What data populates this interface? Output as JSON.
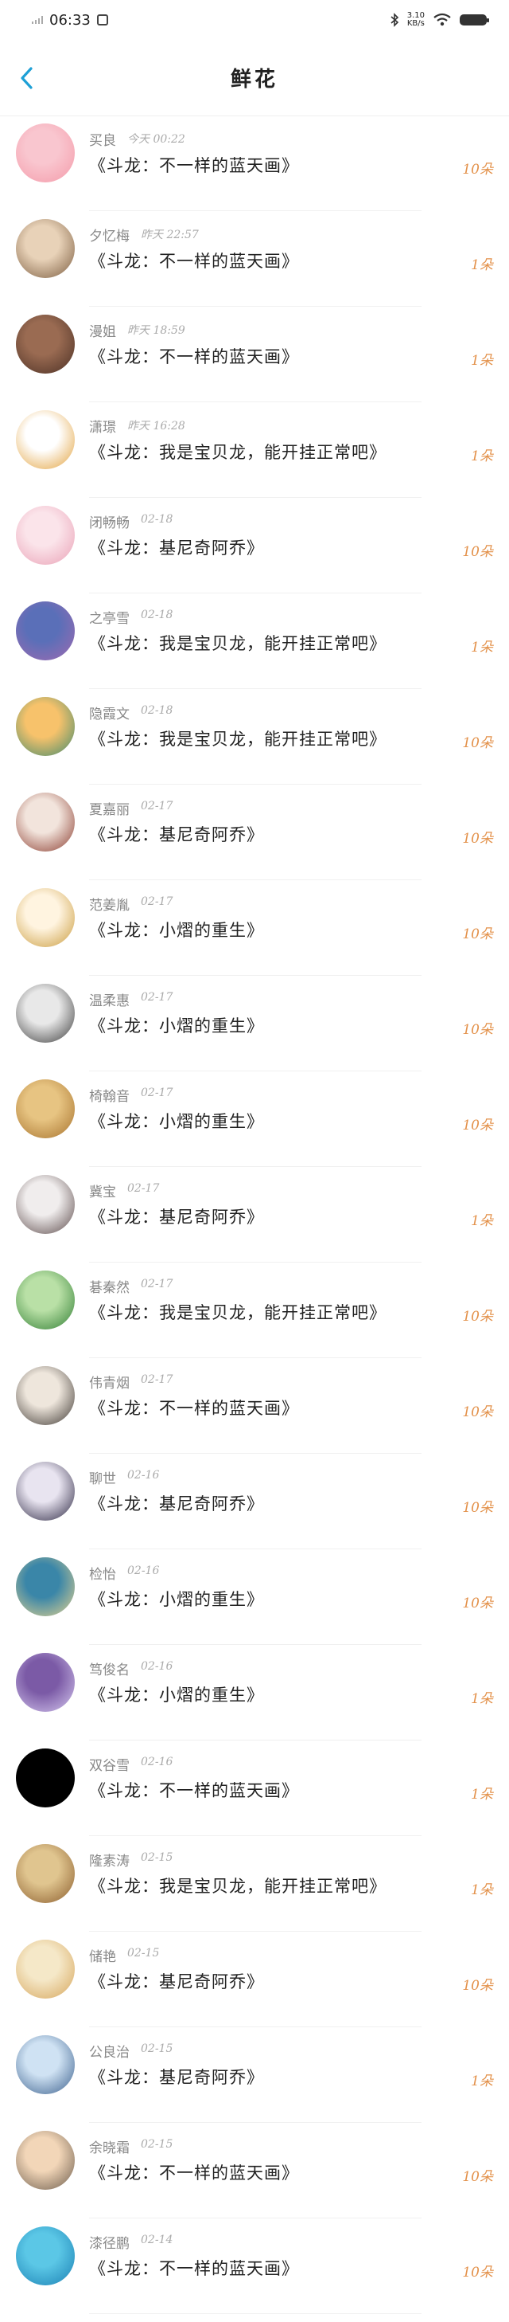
{
  "status": {
    "time": "06:33",
    "speed_top": "3.10",
    "speed_bottom": "KB/s"
  },
  "header": {
    "title": "鲜花"
  },
  "colors": {
    "accent": "#1ea0d6",
    "count": "#e3914a"
  },
  "items": [
    {
      "name": "买良",
      "time": "今天 00:22",
      "book": "《斗龙：不一样的蓝天画》",
      "count": "10朵",
      "avatar": [
        "#f9c6cf",
        "#f49aa9"
      ]
    },
    {
      "name": "夕忆梅",
      "time": "昨天 22:57",
      "book": "《斗龙：不一样的蓝天画》",
      "count": "1朵",
      "avatar": [
        "#e8d2b8",
        "#7a5b3e"
      ]
    },
    {
      "name": "漫姐",
      "time": "昨天 18:59",
      "book": "《斗龙：不一样的蓝天画》",
      "count": "1朵",
      "avatar": [
        "#9a6b52",
        "#4a2f24"
      ]
    },
    {
      "name": "潇璟",
      "time": "昨天 16:28",
      "book": "《斗龙：我是宝贝龙，能开挂正常吧》",
      "count": "1朵",
      "avatar": [
        "#ffffff",
        "#e2a13b"
      ]
    },
    {
      "name": "闭畅畅",
      "time": "02-18",
      "book": "《斗龙：基尼奇阿乔》",
      "count": "10朵",
      "avatar": [
        "#fbe4ea",
        "#e9a0b5"
      ]
    },
    {
      "name": "之亭雪",
      "time": "02-18",
      "book": "《斗龙：我是宝贝龙，能开挂正常吧》",
      "count": "1朵",
      "avatar": [
        "#5a6fb8",
        "#a06ab0"
      ]
    },
    {
      "name": "隐霞文",
      "time": "02-18",
      "book": "《斗龙：我是宝贝龙，能开挂正常吧》",
      "count": "10朵",
      "avatar": [
        "#f7c26b",
        "#3e8a6e"
      ]
    },
    {
      "name": "夏嘉丽",
      "time": "02-17",
      "book": "《斗龙：基尼奇阿乔》",
      "count": "10朵",
      "avatar": [
        "#f2e4dc",
        "#8a3b2e"
      ]
    },
    {
      "name": "范姜胤",
      "time": "02-17",
      "book": "《斗龙：小熠的重生》",
      "count": "10朵",
      "avatar": [
        "#fff4e0",
        "#c99a3b"
      ]
    },
    {
      "name": "温柔惠",
      "time": "02-17",
      "book": "《斗龙：小熠的重生》",
      "count": "10朵",
      "avatar": [
        "#e8e8e8",
        "#3a3a3a"
      ]
    },
    {
      "name": "椅翰音",
      "time": "02-17",
      "book": "《斗龙：小熠的重生》",
      "count": "10朵",
      "avatar": [
        "#e7c482",
        "#a6712c"
      ]
    },
    {
      "name": "冀宝",
      "time": "02-17",
      "book": "《斗龙：基尼奇阿乔》",
      "count": "1朵",
      "avatar": [
        "#f0eded",
        "#5a4848"
      ]
    },
    {
      "name": "碁秦然",
      "time": "02-17",
      "book": "《斗龙：我是宝贝龙，能开挂正常吧》",
      "count": "10朵",
      "avatar": [
        "#b9e0a6",
        "#2f7d32"
      ]
    },
    {
      "name": "伟青烟",
      "time": "02-17",
      "book": "《斗龙：不一样的蓝天画》",
      "count": "10朵",
      "avatar": [
        "#eee6dc",
        "#3b3530"
      ]
    },
    {
      "name": "聊世",
      "time": "02-16",
      "book": "《斗龙：基尼奇阿乔》",
      "count": "10朵",
      "avatar": [
        "#e8e4f0",
        "#2a2540"
      ]
    },
    {
      "name": "检怡",
      "time": "02-16",
      "book": "《斗龙：小熠的重生》",
      "count": "10朵",
      "avatar": [
        "#3a86a8",
        "#e6d38f"
      ]
    },
    {
      "name": "笃俊名",
      "time": "02-16",
      "book": "《斗龙：小熠的重生》",
      "count": "1朵",
      "avatar": [
        "#7b5aa6",
        "#d6c9ef"
      ]
    },
    {
      "name": "双谷雪",
      "time": "02-16",
      "book": "《斗龙：不一样的蓝天画》",
      "count": "1朵",
      "avatar": [
        "#000000",
        "#000000"
      ]
    },
    {
      "name": "隆素涛",
      "time": "02-15",
      "book": "《斗龙：我是宝贝龙，能开挂正常吧》",
      "count": "1朵",
      "avatar": [
        "#e0c58f",
        "#8a5c2c"
      ]
    },
    {
      "name": "储艳",
      "time": "02-15",
      "book": "《斗龙：基尼奇阿乔》",
      "count": "10朵",
      "avatar": [
        "#f5e8c8",
        "#d6a55a"
      ]
    },
    {
      "name": "公良治",
      "time": "02-15",
      "book": "《斗龙：基尼奇阿乔》",
      "count": "1朵",
      "avatar": [
        "#cfe2f3",
        "#3a5f8c"
      ]
    },
    {
      "name": "余晓霜",
      "time": "02-15",
      "book": "《斗龙：不一样的蓝天画》",
      "count": "10朵",
      "avatar": [
        "#f2d6b8",
        "#6a5a4a"
      ]
    },
    {
      "name": "漆径鹏",
      "time": "02-14",
      "book": "《斗龙：不一样的蓝天画》",
      "count": "10朵",
      "avatar": [
        "#5bc7e6",
        "#1a7fb3"
      ]
    }
  ]
}
